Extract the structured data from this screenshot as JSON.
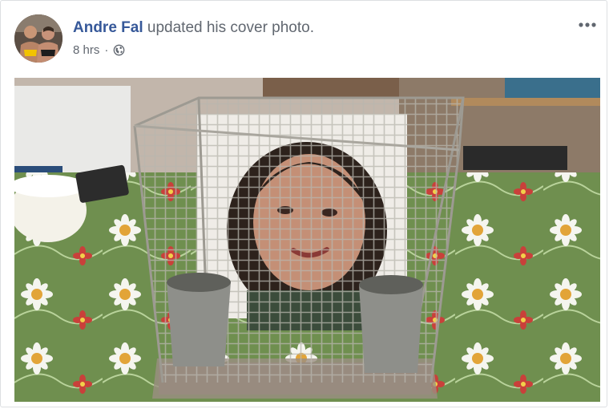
{
  "post": {
    "author_name": "Andre Fal",
    "action": "updated his cover photo.",
    "timestamp": "8 hrs",
    "separator": "·"
  },
  "icons": {
    "audience": "globe-icon",
    "menu": "more-options-icon"
  },
  "colors": {
    "author_link": "#365899",
    "secondary_text": "#616770",
    "border": "#dddfe2"
  }
}
